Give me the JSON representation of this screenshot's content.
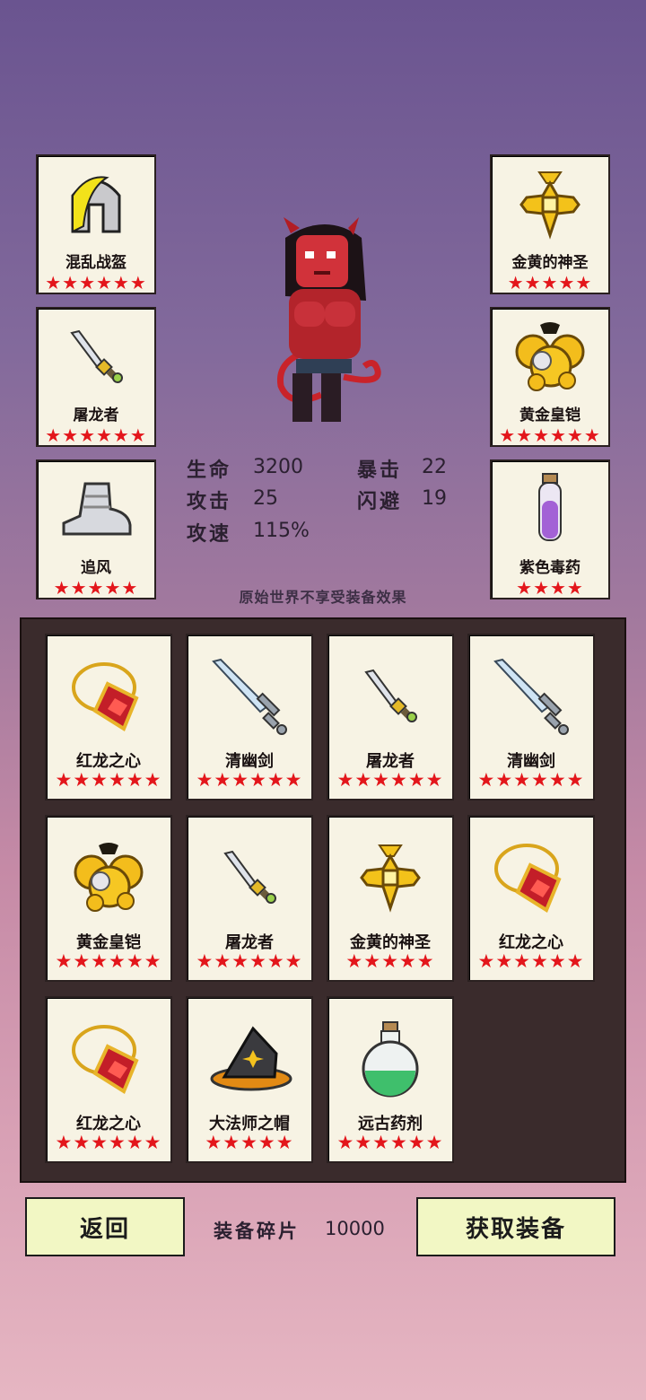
{
  "equipped_left": [
    {
      "name": "混乱战盔",
      "stars": 6,
      "icon": "helmet-icon"
    },
    {
      "name": "屠龙者",
      "stars": 6,
      "icon": "dagger-icon"
    },
    {
      "name": "追风",
      "stars": 5,
      "icon": "boot-icon"
    }
  ],
  "equipped_right": [
    {
      "name": "金黄的神圣",
      "stars": 5,
      "icon": "holy-cross-icon"
    },
    {
      "name": "黄金皇铠",
      "stars": 6,
      "icon": "gold-armor-icon"
    },
    {
      "name": "紫色毒药",
      "stars": 4,
      "icon": "potion-vial-icon"
    }
  ],
  "stats": {
    "hp_label": "生命",
    "hp": "3200",
    "atk_label": "攻击",
    "atk": "25",
    "aspd_label": "攻速",
    "aspd": "115%",
    "crit_label": "暴击",
    "crit": "22",
    "dodge_label": "闪避",
    "dodge": "19"
  },
  "note": "原始世界不享受装备效果",
  "inventory": [
    {
      "name": "红龙之心",
      "stars": 6,
      "icon": "amulet-icon"
    },
    {
      "name": "清幽剑",
      "stars": 6,
      "icon": "sword-icon"
    },
    {
      "name": "屠龙者",
      "stars": 6,
      "icon": "dagger-icon"
    },
    {
      "name": "清幽剑",
      "stars": 6,
      "icon": "sword-icon"
    },
    {
      "name": "黄金皇铠",
      "stars": 6,
      "icon": "gold-armor-icon"
    },
    {
      "name": "屠龙者",
      "stars": 6,
      "icon": "dagger-icon"
    },
    {
      "name": "金黄的神圣",
      "stars": 5,
      "icon": "holy-cross-icon"
    },
    {
      "name": "红龙之心",
      "stars": 6,
      "icon": "amulet-icon"
    },
    {
      "name": "红龙之心",
      "stars": 6,
      "icon": "amulet-icon"
    },
    {
      "name": "大法师之帽",
      "stars": 5,
      "icon": "wizard-hat-icon"
    },
    {
      "name": "远古药剂",
      "stars": 6,
      "icon": "flask-icon"
    }
  ],
  "footer": {
    "back_label": "返回",
    "fragments_label": "装备碎片",
    "fragments_value": "10000",
    "get_label": "获取装备"
  },
  "colors": {
    "star": "#e3161b",
    "card_bg": "#f7f3e4",
    "button_bg": "#f2f7c4",
    "panel_bg": "#3a2b2c"
  }
}
